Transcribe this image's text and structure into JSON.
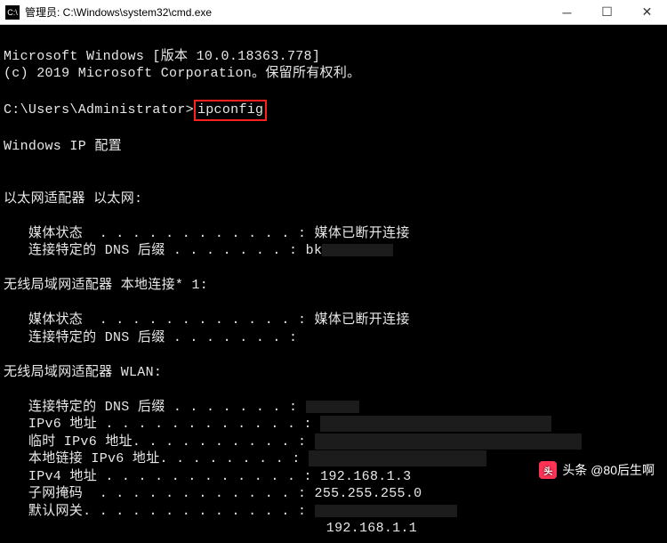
{
  "titlebar": {
    "icon_text": "C:\\",
    "title": "管理员: C:\\Windows\\system32\\cmd.exe"
  },
  "terminal": {
    "line_winver": "Microsoft Windows [版本 10.0.18363.778]",
    "line_copyright": "(c) 2019 Microsoft Corporation。保留所有权利。",
    "prompt": "C:\\Users\\Administrator>",
    "command": "ipconfig",
    "section_title": "Windows IP 配置",
    "adapter1_header": "以太网适配器 以太网:",
    "media_state_label": "   媒体状态  . . . . . . . . . . . . : ",
    "media_state_value": "媒体已断开连接",
    "dns_suffix_label": "   连接特定的 DNS 后缀 . . . . . . . : ",
    "dns_suffix_value_partial": "bk",
    "adapter2_header": "无线局域网适配器 本地连接* 1:",
    "adapter3_header": "无线局域网适配器 WLAN:",
    "ipv6_label": "   IPv6 地址 . . . . . . . . . . . . : ",
    "temp_ipv6_label": "   临时 IPv6 地址. . . . . . . . . . : ",
    "link_local_label": "   本地链接 IPv6 地址. . . . . . . . : ",
    "ipv4_label": "   IPv4 地址 . . . . . . . . . . . . : ",
    "ipv4_value": "192.168.1.3",
    "subnet_label": "   子网掩码  . . . . . . . . . . . . : ",
    "subnet_value": "255.255.255.0",
    "gateway_label": "   默认网关. . . . . . . . . . . . . : ",
    "gateway_extra_value": "192.168.1.1"
  },
  "watermark": {
    "badge": "头",
    "label": "头条",
    "user": "@80后生啊"
  }
}
